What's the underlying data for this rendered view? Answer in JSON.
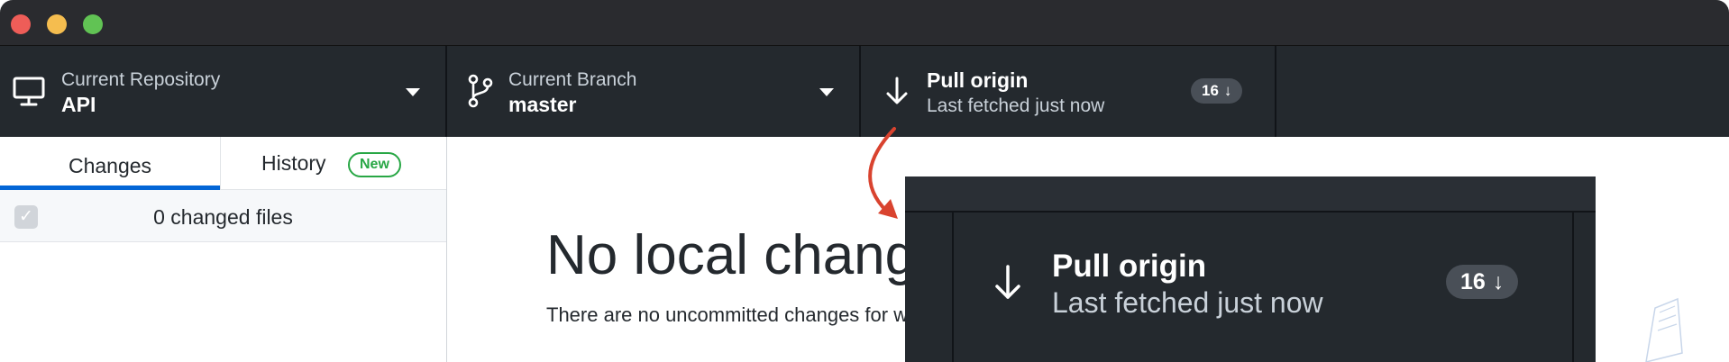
{
  "window": {
    "traffic_lights": [
      "close",
      "minimize",
      "zoom"
    ]
  },
  "toolbar": {
    "repository": {
      "label": "Current Repository",
      "value": "API",
      "icon": "desktop-icon"
    },
    "branch": {
      "label": "Current Branch",
      "value": "master",
      "icon": "git-branch-icon"
    },
    "pull": {
      "label": "Pull origin",
      "status": "Last fetched just now",
      "count": "16",
      "icon": "arrow-down-icon"
    }
  },
  "sidebar": {
    "tabs": [
      {
        "label": "Changes",
        "selected": true
      },
      {
        "label": "History",
        "badge": "New",
        "selected": false
      }
    ],
    "changed_files": "0 changed files"
  },
  "main": {
    "heading": "No local chang",
    "description": "There are no uncommitted changes for what to do next."
  },
  "zoom_callout": {
    "label": "Pull origin",
    "status": "Last fetched just now",
    "count": "16"
  },
  "colors": {
    "toolbar_bg": "#24292e",
    "accent_blue": "#0366d6",
    "new_badge_green": "#28a745",
    "annotation_arrow": "#d9432f"
  }
}
